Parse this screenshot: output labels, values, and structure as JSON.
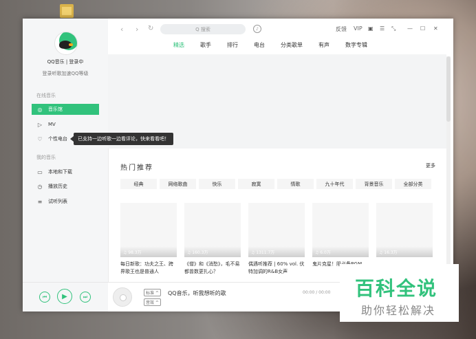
{
  "sidebar": {
    "login": "QQ音乐 | 登录中",
    "level": "登录听歌加速QQ等级",
    "section_online": "在线音乐",
    "section_mine": "我的音乐",
    "items": [
      {
        "label": "音乐馆",
        "icon": "compass-icon"
      },
      {
        "label": "MV",
        "icon": "video-icon"
      },
      {
        "label": "个性电台",
        "icon": "heart-icon"
      },
      {
        "label": "本地和下载",
        "icon": "monitor-icon"
      },
      {
        "label": "播放历史",
        "icon": "clock-icon"
      },
      {
        "label": "试听列表",
        "icon": "list-icon"
      }
    ]
  },
  "tooltip": "已支持一边听歌一边看评论，快来看看吧！",
  "topbar": {
    "search_placeholder": "Q 搜索",
    "feedback": "反馈",
    "vip": "VIP",
    "tabs": [
      "精选",
      "歌手",
      "排行",
      "电台",
      "分类歌单",
      "有声",
      "数字专辑"
    ]
  },
  "main": {
    "hot_title": "热门推荐",
    "more": "更多",
    "categories": [
      "经典",
      "网络歌曲",
      "快乐",
      "寂寞",
      "情歌",
      "九十年代",
      "背景音乐",
      "全部分类"
    ],
    "cards": [
      {
        "plays": "98.3万",
        "title": "每日新歌：功夫之王、跨界歌王也是普通人"
      },
      {
        "plays": "160.3万",
        "title": "《僧》和《消愁》，毛不易都曾数更扎心？"
      },
      {
        "plays": "1311.7万",
        "title": "偶遇听推荐 | 60% vol. 伏特加调的R&B女声"
      },
      {
        "plays": "6.0万",
        "title": "鬼片克星！阻必备BGM"
      },
      {
        "plays": "16.3万",
        "title": ""
      }
    ]
  },
  "player": {
    "chip_standard": "标准",
    "chip_lyric": "音效",
    "track": "QQ音乐，听我想听的歌",
    "time": "00:00 / 00:00"
  },
  "watermark": {
    "big": "百科全说",
    "small": "助你轻松解决"
  },
  "colors": {
    "accent": "#31c27c"
  }
}
